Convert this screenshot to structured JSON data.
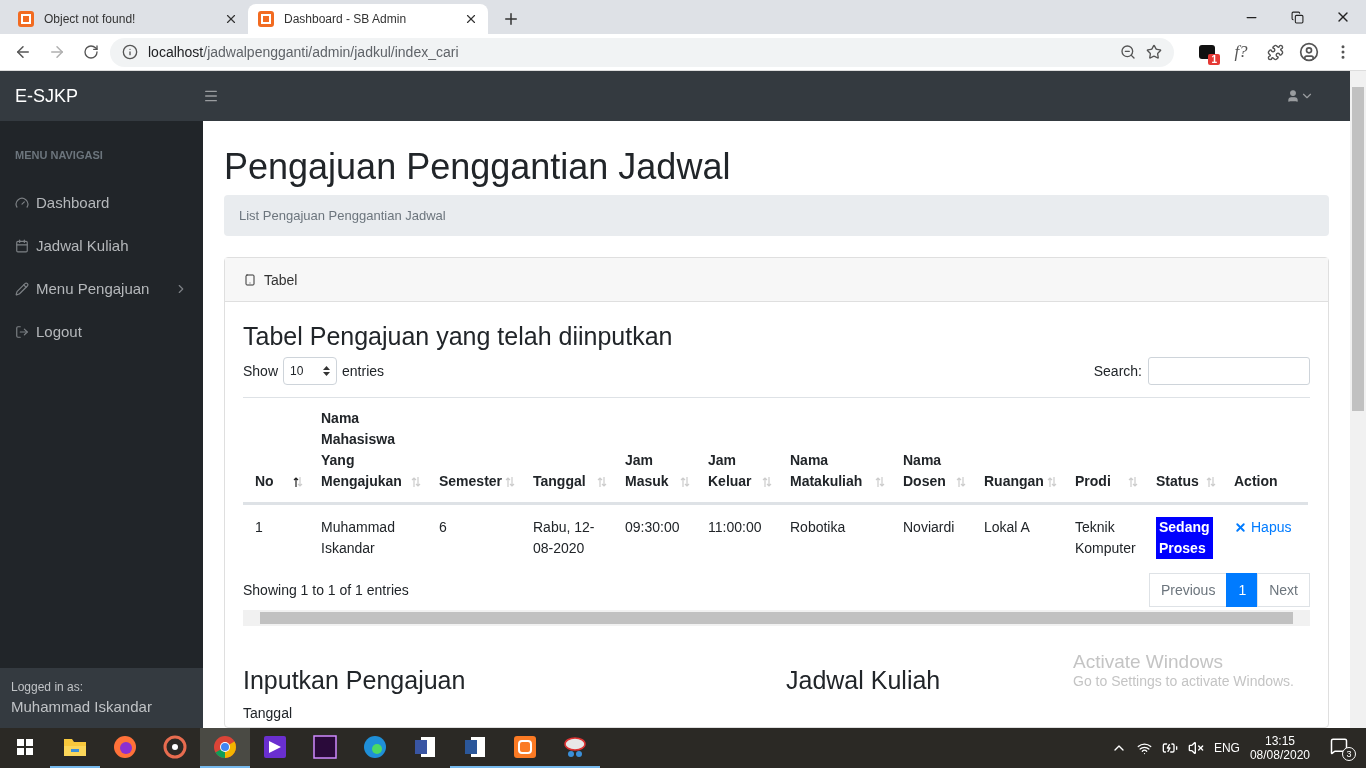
{
  "browser": {
    "tabs": [
      {
        "title": "Object not found!",
        "selected": false
      },
      {
        "title": "Dashboard - SB Admin",
        "selected": true
      }
    ],
    "nav": {
      "back_disabled": false,
      "forward_disabled": true
    },
    "url": {
      "host": "localhost",
      "path": "/jadwalpengganti/admin/jadkul/index_cari"
    },
    "extension_badge": "1",
    "extension_label": "f?"
  },
  "navbar": {
    "brand": "E-SJKP"
  },
  "sidebar": {
    "heading": "MENU NAVIGASI",
    "items": [
      {
        "label": "Dashboard",
        "kind": "dashboard",
        "has_children": false
      },
      {
        "label": "Jadwal Kuliah",
        "kind": "calendar",
        "has_children": false
      },
      {
        "label": "Menu Pengajuan",
        "kind": "edit",
        "has_children": true
      },
      {
        "label": "Logout",
        "kind": "logout",
        "has_children": false
      }
    ],
    "footer": {
      "caption": "Logged in as:",
      "user": "Muhammad Iskandar"
    }
  },
  "page": {
    "title": "Pengajuan Penggantian Jadwal",
    "breadcrumb": "List Pengajuan Penggantian Jadwal"
  },
  "card": {
    "header": "Tabel",
    "title": "Tabel Pengajuan yang telah diinputkan",
    "length": {
      "before": "Show",
      "value": "10",
      "after": "entries"
    },
    "search_label": "Search:",
    "table": {
      "columns": [
        {
          "label": "No",
          "sorted": true
        },
        {
          "label": "Nama Mahasiswa Yang Mengajukan",
          "sorted": false
        },
        {
          "label": "Semester",
          "sorted": false
        },
        {
          "label": "Tanggal",
          "sorted": false
        },
        {
          "label": "Jam Masuk",
          "sorted": false
        },
        {
          "label": "Jam Keluar",
          "sorted": false
        },
        {
          "label": "Nama Matakuliah",
          "sorted": false
        },
        {
          "label": "Nama Dosen",
          "sorted": false
        },
        {
          "label": "Ruangan",
          "sorted": false
        },
        {
          "label": "Prodi",
          "sorted": false
        },
        {
          "label": "Status",
          "sorted": false
        },
        {
          "label": "Action"
        }
      ],
      "rows": [
        {
          "cells": [
            "1",
            "Muhammad Iskandar",
            "6",
            "Rabu, 12-08-2020",
            "09:30:00",
            "11:00:00",
            "Robotika",
            "Noviardi",
            "Lokal A",
            "Teknik Komputer"
          ],
          "status": "Sedang Proses",
          "action": "Hapus"
        }
      ]
    },
    "info": "Showing 1 to 1 of 1 entries",
    "pagination": [
      {
        "label": "Previous",
        "selected": false
      },
      {
        "label": "1",
        "selected": true
      },
      {
        "label": "Next",
        "selected": false
      }
    ],
    "form_title": "Inputkan Pengajuan",
    "form_field": "Tanggal",
    "schedule_title": "Jadwal Kuliah"
  },
  "activation": {
    "title": "Activate Windows",
    "text": "Go to Settings to activate Windows."
  },
  "taskbar": {
    "apps": [
      {
        "kind": "folder",
        "running": true,
        "selected": false
      },
      {
        "kind": "firefox",
        "running": false,
        "selected": false
      },
      {
        "kind": "disc",
        "running": false,
        "selected": false
      },
      {
        "kind": "chrome",
        "running": true,
        "selected": true
      },
      {
        "kind": "vs",
        "running": false,
        "selected": false
      },
      {
        "kind": "premiere",
        "running": false,
        "selected": false
      },
      {
        "kind": "edge",
        "running": false,
        "selected": false
      },
      {
        "kind": "visio",
        "running": false,
        "selected": false
      },
      {
        "kind": "word",
        "running": true,
        "selected": false
      },
      {
        "kind": "xampp",
        "running": true,
        "selected": false
      },
      {
        "kind": "snip",
        "running": true,
        "selected": false
      }
    ],
    "language": "ENG",
    "time": "13:15",
    "date": "08/08/2020",
    "notifications": "3"
  }
}
